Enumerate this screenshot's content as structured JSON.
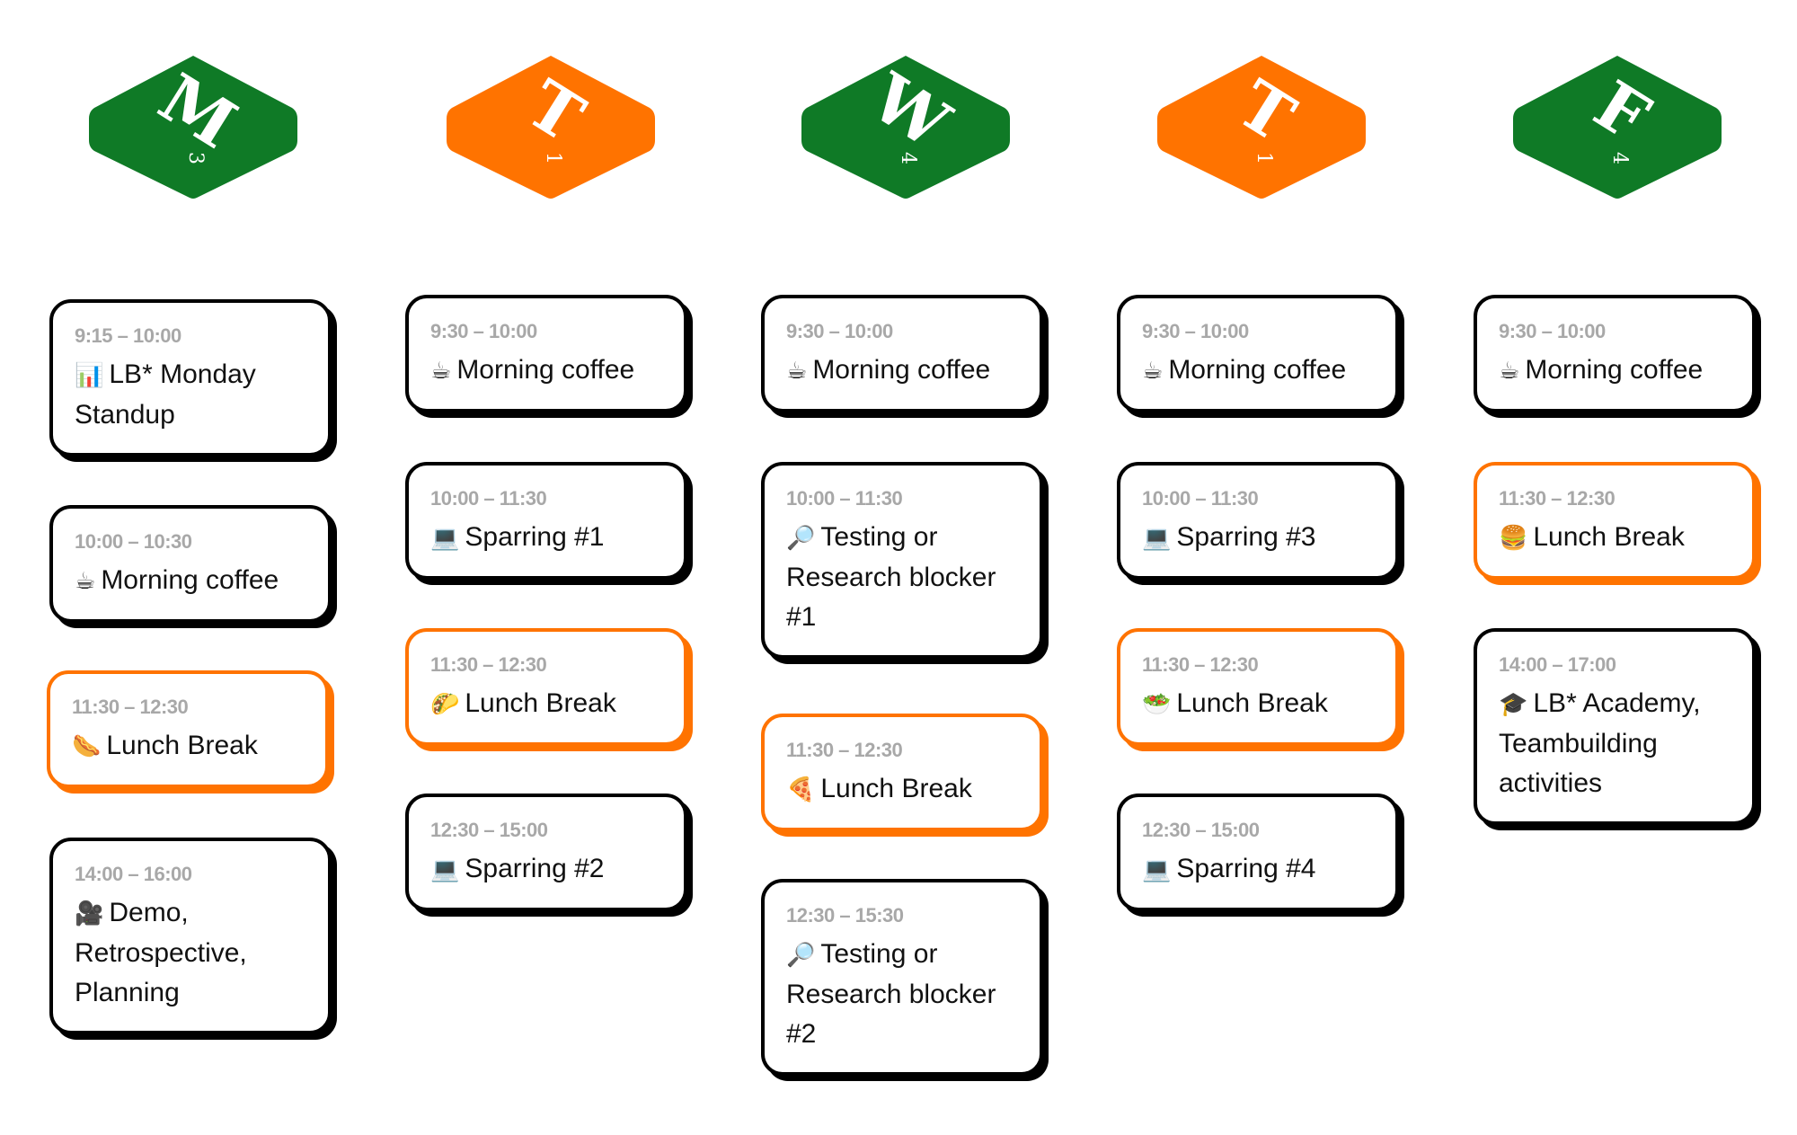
{
  "colors": {
    "green": "#0f7a26",
    "orange": "#ff7300",
    "card_border": "#000000",
    "time_text": "#a8a8a8"
  },
  "days": [
    {
      "letter": "M",
      "number": "3",
      "color": "green",
      "events": [
        {
          "time": "9:15 – 10:00",
          "icon": "bar-chart-icon",
          "emoji": "📊",
          "title": "LB* Monday Standup",
          "type": "normal"
        },
        {
          "time": "10:00 – 10:30",
          "icon": "coffee-icon",
          "emoji": "☕",
          "title": "Morning coffee",
          "type": "normal"
        },
        {
          "time": "11:30 – 12:30",
          "icon": "hotdog-icon",
          "emoji": "🌭",
          "title": "Lunch Break",
          "type": "lunch"
        },
        {
          "time": "14:00 – 16:00",
          "icon": "movie-camera-icon",
          "emoji": "🎥",
          "title": "Demo, Retrospective, Planning",
          "type": "normal"
        }
      ]
    },
    {
      "letter": "T",
      "number": "1",
      "color": "orange",
      "events": [
        {
          "time": "9:30 – 10:00",
          "icon": "coffee-icon",
          "emoji": "☕",
          "title": "Morning coffee",
          "type": "normal"
        },
        {
          "time": "10:00 – 11:30",
          "icon": "laptop-icon",
          "emoji": "💻",
          "title": "Sparring #1",
          "type": "normal"
        },
        {
          "time": "11:30 – 12:30",
          "icon": "taco-icon",
          "emoji": "🌮",
          "title": "Lunch Break",
          "type": "lunch"
        },
        {
          "time": "12:30 – 15:00",
          "icon": "laptop-icon",
          "emoji": "💻",
          "title": "Sparring #2",
          "type": "normal"
        }
      ]
    },
    {
      "letter": "W",
      "number": "4",
      "color": "green",
      "events": [
        {
          "time": "9:30 – 10:00",
          "icon": "coffee-icon",
          "emoji": "☕",
          "title": "Morning coffee",
          "type": "normal"
        },
        {
          "time": "10:00 – 11:30",
          "icon": "magnifier-icon",
          "emoji": "🔎",
          "title": "Testing or Research blocker #1",
          "type": "normal"
        },
        {
          "time": "11:30 – 12:30",
          "icon": "pizza-icon",
          "emoji": "🍕",
          "title": "Lunch Break",
          "type": "lunch"
        },
        {
          "time": "12:30 – 15:30",
          "icon": "magnifier-icon",
          "emoji": "🔎",
          "title": "Testing or Research blocker #2",
          "type": "normal"
        }
      ]
    },
    {
      "letter": "T",
      "number": "1",
      "color": "orange",
      "events": [
        {
          "time": "9:30 – 10:00",
          "icon": "coffee-icon",
          "emoji": "☕",
          "title": "Morning coffee",
          "type": "normal"
        },
        {
          "time": "10:00 – 11:30",
          "icon": "laptop-icon",
          "emoji": "💻",
          "title": "Sparring #3",
          "type": "normal"
        },
        {
          "time": "11:30 – 12:30",
          "icon": "salad-icon",
          "emoji": "🥗",
          "title": "Lunch Break",
          "type": "lunch"
        },
        {
          "time": "12:30 – 15:00",
          "icon": "laptop-icon",
          "emoji": "💻",
          "title": "Sparring #4",
          "type": "normal"
        }
      ]
    },
    {
      "letter": "F",
      "number": "4",
      "color": "green",
      "events": [
        {
          "time": "9:30 – 10:00",
          "icon": "coffee-icon",
          "emoji": "☕",
          "title": "Morning coffee",
          "type": "normal"
        },
        {
          "time": "11:30 – 12:30",
          "icon": "burger-icon",
          "emoji": "🍔",
          "title": "Lunch Break",
          "type": "lunch"
        },
        {
          "time": "14:00 – 17:00",
          "icon": "graduation-cap-icon",
          "emoji": "🎓",
          "title": "LB* Academy, Teambuilding activities",
          "type": "normal"
        }
      ]
    }
  ]
}
